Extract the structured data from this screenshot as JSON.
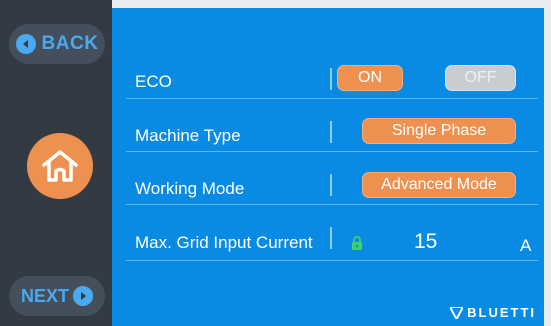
{
  "nav": {
    "back_label": "BACK",
    "next_label": "NEXT"
  },
  "settings": {
    "eco": {
      "label": "ECO",
      "on_label": "ON",
      "off_label": "OFF",
      "selected": "ON"
    },
    "machine_type": {
      "label": "Machine Type",
      "value": "Single Phase"
    },
    "working_mode": {
      "label": "Working Mode",
      "value": "Advanced Mode"
    },
    "max_grid_current": {
      "label": "Max. Grid Input Current",
      "value": "15",
      "unit": "A"
    }
  },
  "brand": {
    "name": "BLUETTI"
  },
  "colors": {
    "accent": "#ee9150",
    "panel": "#0a8be3",
    "sidebar": "#323a44",
    "nav_text": "#4aa9f0",
    "lock": "#3fd06b"
  }
}
